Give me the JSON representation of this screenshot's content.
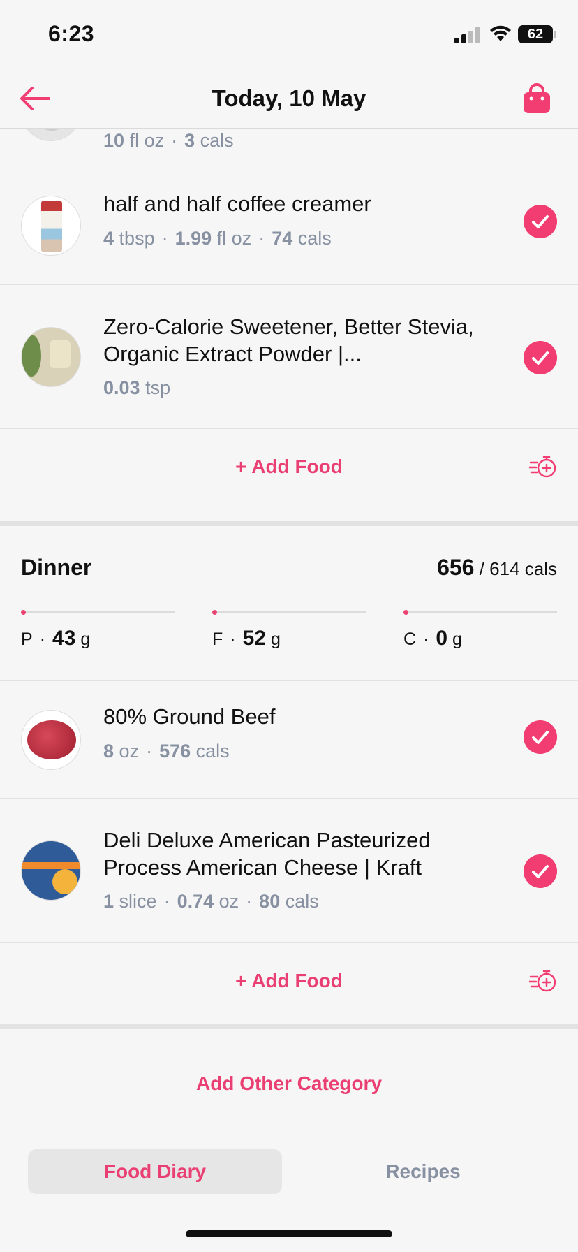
{
  "status_bar": {
    "time": "6:23",
    "battery": "62"
  },
  "header": {
    "title": "Today, 10 May"
  },
  "breakfast": {
    "items": [
      {
        "name": "",
        "qty_num": "10",
        "qty_unit": "fl oz",
        "cals_num": "3",
        "cals_unit": "cals"
      },
      {
        "name": "half and half coffee creamer",
        "qty_num": "4",
        "qty_unit": "tbsp",
        "qty2_num": "1.99",
        "qty2_unit": "fl oz",
        "cals_num": "74",
        "cals_unit": "cals"
      },
      {
        "name": "Zero-Calorie Sweetener, Better Stevia, Organic Extract Powder |...",
        "qty_num": "0.03",
        "qty_unit": "tsp"
      }
    ],
    "add_food_label": "+ Add Food"
  },
  "dinner": {
    "title": "Dinner",
    "cals_eaten": "656",
    "cals_target": "/ 614 cals",
    "macros": [
      {
        "letter": "P",
        "value": "43",
        "unit": "g",
        "progress": 0.0
      },
      {
        "letter": "F",
        "value": "52",
        "unit": "g",
        "progress": 0.0
      },
      {
        "letter": "C",
        "value": "0",
        "unit": "g",
        "progress": 0.0
      }
    ],
    "items": [
      {
        "name": "80% Ground Beef",
        "qty_num": "8",
        "qty_unit": "oz",
        "cals_num": "576",
        "cals_unit": "cals"
      },
      {
        "name": "Deli Deluxe American Pasteurized Process American Cheese | Kraft",
        "qty_num": "1",
        "qty_unit": "slice",
        "qty2_num": "0.74",
        "qty2_unit": "oz",
        "cals_num": "80",
        "cals_unit": "cals"
      }
    ],
    "add_food_label": "+ Add Food"
  },
  "add_other_category": "Add Other Category",
  "tabs": [
    {
      "label": "Food Diary",
      "active": true
    },
    {
      "label": "Recipes",
      "active": false
    }
  ],
  "colors": {
    "accent": "#f23d72",
    "muted": "#8791a1",
    "background": "#f6f6f6"
  },
  "icons": {
    "back": "arrow-left-icon",
    "basket": "shopping-bag-icon",
    "check": "checkmark-icon",
    "timer": "add-timer-icon"
  }
}
